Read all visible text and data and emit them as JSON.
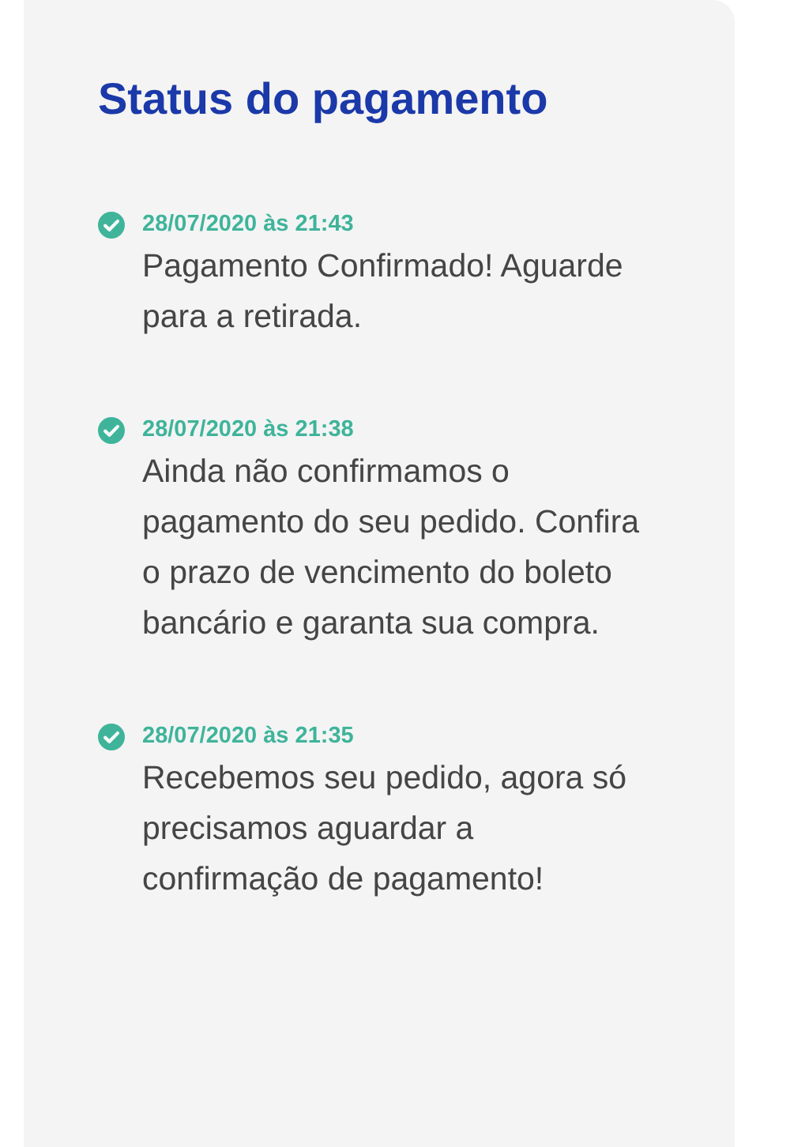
{
  "title": "Status do pagamento",
  "events": [
    {
      "date": "28/07/2020 às 21:43",
      "text": "Pagamento Confirmado! Aguarde para a retirada."
    },
    {
      "date": "28/07/2020 às 21:38",
      "text": "Ainda não confirmamos o pagamento do seu pedido. Confira o prazo de vencimento do boleto bancário e garanta sua compra."
    },
    {
      "date": "28/07/2020 às 21:35",
      "text": "Recebemos seu pedido, agora só precisamos aguardar a confirmação de pagamento!"
    }
  ]
}
